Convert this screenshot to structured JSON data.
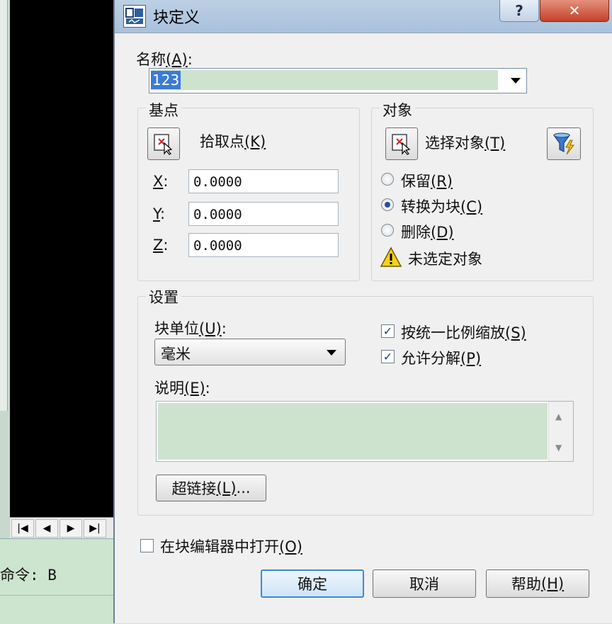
{
  "dialog": {
    "title": "块定义",
    "help_glyph": "?",
    "close_glyph": "✕"
  },
  "name": {
    "label": "名称",
    "hotkey": "(A)",
    "suffix": ":",
    "value": "123"
  },
  "base_point": {
    "group_title": "基点",
    "pick_label": "拾取点",
    "pick_hotkey": "(K)",
    "x_label": "X",
    "y_label": "Y",
    "z_label": "Z",
    "coord_suffix": ":",
    "x": "0.0000",
    "y": "0.0000",
    "z": "0.0000"
  },
  "objects": {
    "group_title": "对象",
    "select_label": "选择对象",
    "select_hotkey": "(T)",
    "retain_label": "保留",
    "retain_hotkey": "(R)",
    "convert_label": "转换为块",
    "convert_hotkey": "(C)",
    "delete_label": "删除",
    "delete_hotkey": "(D)",
    "selected_option": "convert",
    "status": "未选定对象"
  },
  "settings": {
    "group_title": "设置",
    "unit_label": "块单位",
    "unit_hotkey": "(U)",
    "unit_suffix": ":",
    "unit_value": "毫米",
    "scale_uniformly": "按统一比例缩放",
    "scale_hotkey": "(S)",
    "allow_explode": "允许分解",
    "explode_hotkey": "(P)",
    "desc_label": "说明",
    "desc_hotkey": "(E)",
    "desc_suffix": ":",
    "hyperlink_label": "超链接",
    "hyperlink_hotkey": "(L)",
    "hyperlink_ellipsis": "..."
  },
  "open_in_editor": {
    "label": "在块编辑器中打开",
    "hotkey": "(O)"
  },
  "buttons": {
    "ok": "确定",
    "cancel": "取消",
    "help": "帮助",
    "help_hotkey": "(H)"
  },
  "background": {
    "command_text": "命令: B",
    "nav": [
      "|◀",
      "◀",
      "▶",
      "▶|"
    ]
  },
  "colors": {
    "accent": "#3b7bd6",
    "input_fill": "#cde3cd",
    "titlebar": "#b5cae2",
    "close": "#c8452f"
  }
}
